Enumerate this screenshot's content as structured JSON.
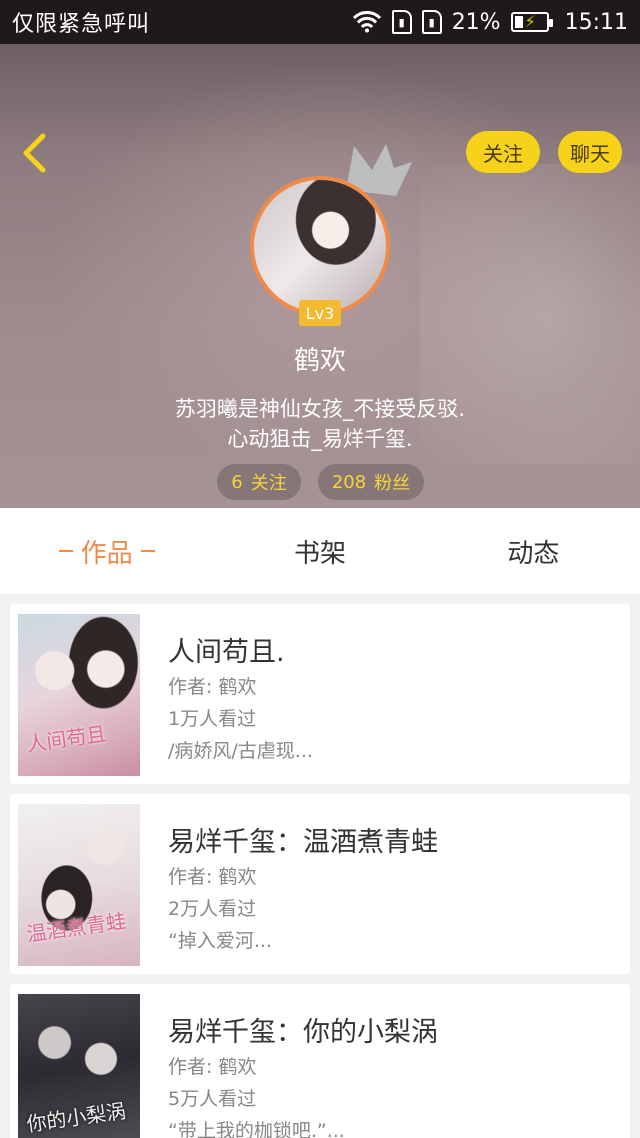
{
  "status_bar": {
    "carrier_text": "仅限紧急呼叫",
    "battery_percent": "21%",
    "time": "15:11",
    "icons": [
      "wifi-icon",
      "sim-icon",
      "sim-icon",
      "battery-charging-icon"
    ]
  },
  "header": {
    "follow_button": "关注",
    "chat_button": "聊天",
    "level": "Lv3",
    "username": "鹤欢",
    "bio_line1": "苏羽曦是神仙女孩_不接受反驳.",
    "bio_line2": "心动狙击_易烊千玺.",
    "following_count": "6",
    "following_label": "关注",
    "fans_count": "208",
    "fans_label": "粉丝",
    "accent_color": "#f7d21a"
  },
  "tabs": [
    {
      "label": "作品",
      "active": true
    },
    {
      "label": "书架",
      "active": false
    },
    {
      "label": "动态",
      "active": false
    }
  ],
  "works": [
    {
      "title": "人间苟且.",
      "author": "作者: 鹤欢",
      "views": "1万人看过",
      "desc": "/病娇风/古虐现...",
      "cover_text": "人间苟且"
    },
    {
      "title": "易烊千玺：温酒煮青蛙",
      "author": "作者: 鹤欢",
      "views": "2万人看过",
      "desc": "“掉入爱河...",
      "cover_text": "温酒煮青蛙"
    },
    {
      "title": "易烊千玺：你的小梨涡",
      "author": "作者: 鹤欢",
      "views": "5万人看过",
      "desc": "“带上我的枷锁吧.”...",
      "cover_text": "你的小梨涡"
    }
  ]
}
